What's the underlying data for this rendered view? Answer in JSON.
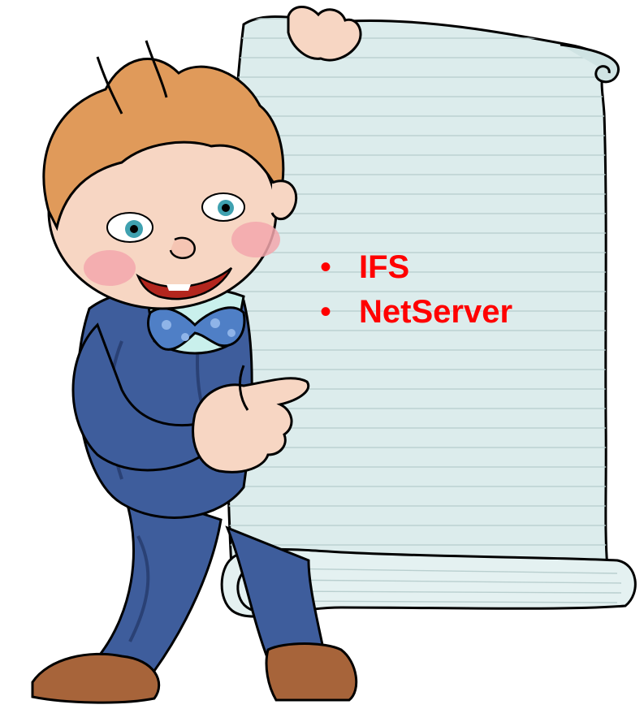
{
  "bullets": [
    {
      "marker": "•",
      "text": "IFS"
    },
    {
      "marker": "•",
      "text": "NetServer"
    }
  ],
  "colors": {
    "bullet_text": "#ff0000",
    "scroll_paper": "#dcecec",
    "scroll_lines": "#b9cfcf",
    "suit": "#3e5d9c",
    "suit_dark": "#2a4175",
    "skin": "#f7d6c3",
    "hair": "#e09a5a",
    "bowtie": "#4f7fc6",
    "shirt": "#c9f0ec",
    "shoes": "#a7643a"
  },
  "illustration": {
    "subject": "boy-holding-scroll",
    "icons": [
      "scroll-icon",
      "boy-icon"
    ]
  }
}
